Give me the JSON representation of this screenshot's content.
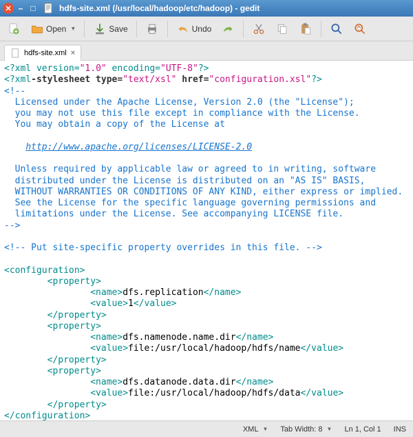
{
  "window": {
    "title": "hdfs-site.xml (/usr/local/hadoop/etc/hadoop) - gedit"
  },
  "toolbar": {
    "open": "Open",
    "save": "Save",
    "undo": "Undo"
  },
  "tab": {
    "name": "hdfs-site.xml",
    "close": "×"
  },
  "code": {
    "l1_a": "<?xml",
    "l1_b": " version=",
    "l1_c": "\"1.0\"",
    "l1_d": " encoding=",
    "l1_e": "\"UTF-8\"",
    "l1_f": "?>",
    "l2_a": "<?xml",
    "l2_b": "-stylesheet type=",
    "l2_c": "\"text/xsl\"",
    "l2_d": " href=",
    "l2_e": "\"configuration.xsl\"",
    "l2_f": "?>",
    "l3": "<!--",
    "l4": "  Licensed under the Apache License, Version 2.0 (the \"License\");",
    "l5": "  you may not use this file except in compliance with the License.",
    "l6": "  You may obtain a copy of the License at",
    "l8pad": "    ",
    "l8url": "http://www.apache.org/licenses/LICENSE-2.0",
    "l10": "  Unless required by applicable law or agreed to in writing, software",
    "l11": "  distributed under the License is distributed on an \"AS IS\" BASIS,",
    "l12": "  WITHOUT WARRANTIES OR CONDITIONS OF ANY KIND, either express or implied.",
    "l13": "  See the License for the specific language governing permissions and",
    "l14": "  limitations under the License. See accompanying LICENSE file.",
    "l15": "-->",
    "l17": "<!-- Put site-specific property overrides in this file. -->",
    "cfg_open": "<configuration>",
    "cfg_close": "</configuration>",
    "prop_open": "<property>",
    "prop_close": "</property>",
    "name_open": "<name>",
    "name_close": "</name>",
    "value_open": "<value>",
    "value_close": "</value>",
    "name1": "dfs.replication",
    "val1": "1",
    "name2": "dfs.namenode.name.dir",
    "val2": "file:/usr/local/hadoop/hdfs/name",
    "name3": "dfs.datanode.data.dir",
    "val3": "file:/usr/local/hadoop/hdfs/data",
    "pad8": "        ",
    "pad16": "                "
  },
  "status": {
    "lang": "XML",
    "tabwidth": "Tab Width: 8",
    "pos": "Ln 1, Col 1",
    "ins": "INS"
  }
}
